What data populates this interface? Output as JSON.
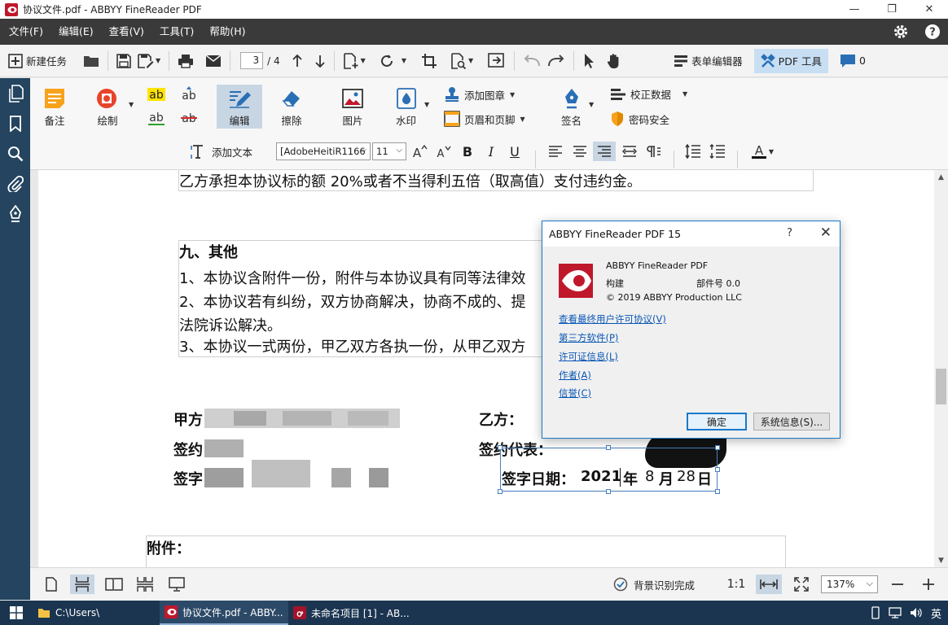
{
  "window": {
    "title": "协议文件.pdf - ABBYY FineReader PDF",
    "minimize": "—",
    "maximize": "❐",
    "close": "✕"
  },
  "menu": {
    "items": [
      "文件(F)",
      "编辑(E)",
      "查看(V)",
      "工具(T)",
      "帮助(H)"
    ]
  },
  "toolbar": {
    "new_task": "新建任务",
    "page_current": "3",
    "page_total": "/ 4",
    "form_editor": "表单编辑器",
    "pdf_tools": "PDF 工具",
    "comments_count": "0"
  },
  "ribbon": {
    "note": "备注",
    "draw": "绘制",
    "edit": "编辑",
    "erase": "擦除",
    "image": "图片",
    "watermark": "水印",
    "add_stamp": "添加图章",
    "header_footer": "页眉和页脚",
    "sign": "签名",
    "correct_data": "校正数据",
    "password_security": "密码安全",
    "hl_ab": "ab"
  },
  "text_toolbar": {
    "add_text": "添加文本",
    "font": "[AdobeHeitiR1166",
    "font_size": "11"
  },
  "document": {
    "line_top": "乙方承担本协议标的额 20%或者不当得利五倍（取高值）支付违约金。",
    "heading": "九、其他",
    "item1": "1、本协议含附件一份，附件与本协议具有同等法律效",
    "item2": "2、本协议若有纠纷，双方协商解决，协商不成的、提",
    "item2b": "法院诉讼解决。",
    "item3": "3、本协议一式两份，甲乙双方各执一份，从甲乙双方",
    "party_a": "甲方",
    "sign_a": "签约",
    "signature_a": "签字",
    "party_b": "乙方：",
    "rep_b": "签约代表：",
    "date_label": "签字日期：",
    "date_year": "2021",
    "date_year_unit": "年",
    "date_month": "8",
    "date_month_unit": "月",
    "date_day": "28",
    "date_day_unit": "日",
    "attachment": "附件："
  },
  "dialog": {
    "title": "ABBYY FineReader PDF 15",
    "help": "?",
    "close": "✕",
    "product": "ABBYY FineReader PDF",
    "build_label": "构建",
    "part_label": "部件号 0.0",
    "copyright": "© 2019 ABBYY Production LLC",
    "links": [
      "查看最终用户许可协议(V)",
      "第三方软件(P)",
      "许可证信息(L)",
      "作者(A)",
      "信誉(C)"
    ],
    "ok": "确定",
    "sysinfo": "系统信息(S)..."
  },
  "statusbar": {
    "bg_recognition": "背景识别完成",
    "ratio": "1:1",
    "zoom": "137%"
  },
  "taskbar": {
    "explorer": "C:\\Users\\",
    "finereader": "协议文件.pdf - ABBY...",
    "untitled": "未命名项目 [1] - AB...",
    "ime": "英"
  },
  "colors": {
    "accent": "#1979ca",
    "menubar": "#3a3a3a",
    "sidebar": "#24445f",
    "brand_red": "#c0182b"
  }
}
